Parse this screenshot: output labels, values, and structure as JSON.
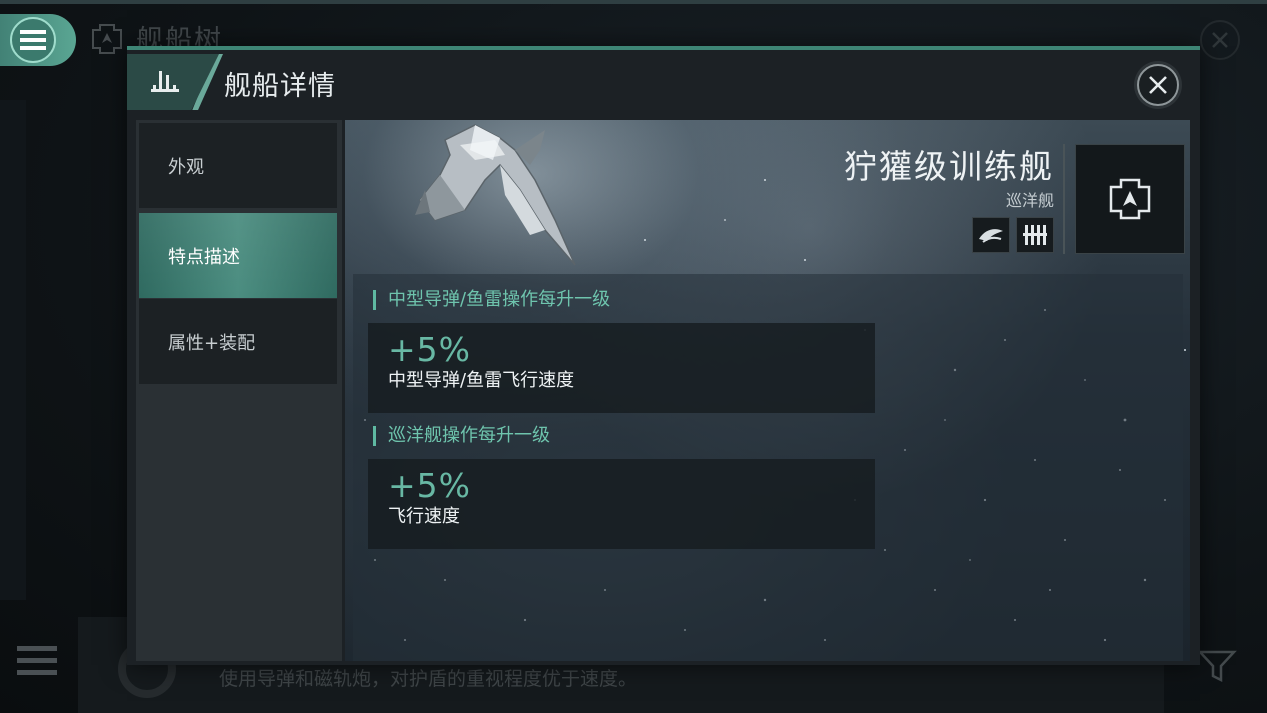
{
  "background": {
    "screen_title": "舰船树",
    "description": "使用导弹和磁轨炮，对护盾的重视程度优于速度。"
  },
  "modal": {
    "title": "舰船详情",
    "tabs": [
      {
        "label": "外观",
        "selected": false
      },
      {
        "label": "特点描述",
        "selected": true
      },
      {
        "label": "属性+装配",
        "selected": false
      }
    ]
  },
  "ship": {
    "name": "狞獾级训练舰",
    "class": "巡洋舰",
    "trait_icons": [
      "faction-icon",
      "missile-launcher-icon"
    ],
    "type_icon": "cruiser-type-icon"
  },
  "traits": [
    {
      "heading": "中型导弹/鱼雷操作每升一级",
      "value": "+5%",
      "description": "中型导弹/鱼雷飞行速度"
    },
    {
      "heading": "巡洋舰操作每升一级",
      "value": "+5%",
      "description": "飞行速度"
    }
  ],
  "colors": {
    "accent": "#5fb9a2",
    "accent_text": "#6ec4ad",
    "selected_tab": "#4b8d80",
    "panel": "#1c2125"
  }
}
